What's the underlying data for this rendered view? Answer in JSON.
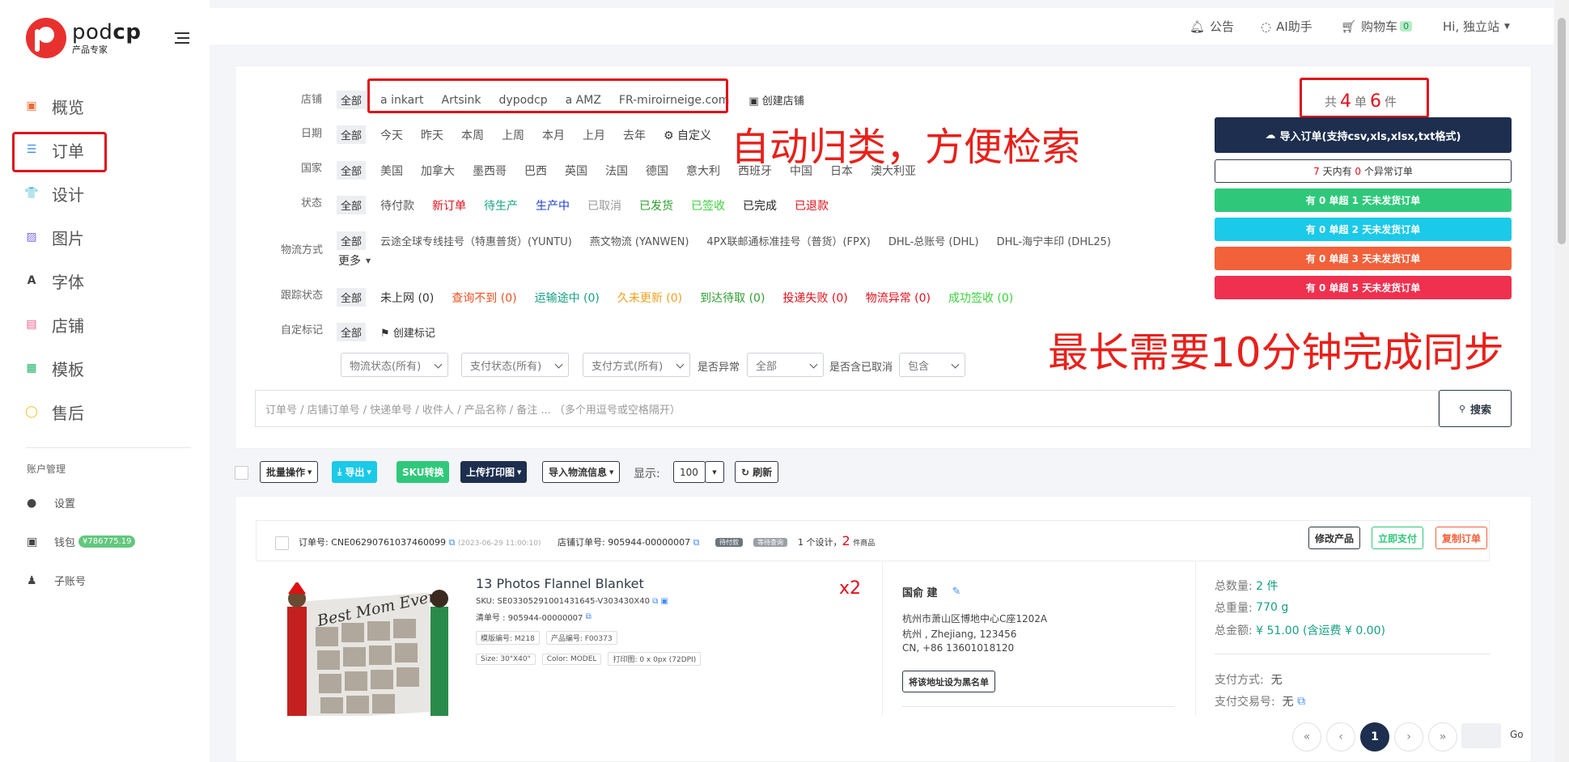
{
  "brand": {
    "name_light": "pod",
    "name_bold": "cp",
    "subtitle": "产品专家"
  },
  "sidebar": {
    "items": [
      {
        "label": "概览"
      },
      {
        "label": "订单"
      },
      {
        "label": "设计"
      },
      {
        "label": "图片"
      },
      {
        "label": "字体"
      },
      {
        "label": "店铺"
      },
      {
        "label": "模板"
      },
      {
        "label": "售后"
      }
    ],
    "account_title": "账户管理",
    "account_items": [
      {
        "label": "设置"
      },
      {
        "label": "钱包",
        "badge": "¥786775.19"
      },
      {
        "label": "子账号"
      }
    ]
  },
  "topbar": {
    "notice": "公告",
    "ai": "AI助手",
    "cart": "购物车",
    "cart_count": "0",
    "user": "Hi, 独立站"
  },
  "filters": {
    "store": {
      "label": "店铺",
      "all": "全部",
      "options": [
        "inkart",
        "Artsink",
        "dypodcp",
        "AMZ",
        "FR-miroirneige.com"
      ],
      "create": "创建店铺"
    },
    "date": {
      "label": "日期",
      "all": "全部",
      "options": [
        "今天",
        "昨天",
        "本周",
        "上周",
        "本月",
        "上月",
        "去年"
      ],
      "custom": "自定义"
    },
    "country": {
      "label": "国家",
      "all": "全部",
      "options": [
        "美国",
        "加拿大",
        "墨西哥",
        "巴西",
        "英国",
        "法国",
        "德国",
        "意大利",
        "西班牙",
        "中国",
        "日本",
        "澳大利亚"
      ]
    },
    "status": {
      "label": "状态",
      "all": "全部",
      "options": [
        "待付款",
        "新订单",
        "待生产",
        "生产中",
        "已取消",
        "已发货",
        "已签收",
        "已完成",
        "已退款"
      ]
    },
    "logistics": {
      "label": "物流方式",
      "all": "全部",
      "options": [
        "云途全球专线挂号（特惠普货）(YUNTU)",
        "燕文物流 (YANWEN)",
        "4PX联邮通标准挂号（普货）(FPX)",
        "DHL-总账号 (DHL)",
        "DHL-海宁丰印 (DHL25)"
      ],
      "more": "更多"
    },
    "tracking": {
      "label": "跟踪状态",
      "all": "全部",
      "options": [
        "未上网 (0)",
        "查询不到 (0)",
        "运输途中 (0)",
        "久未更新 (0)",
        "到达待取 (0)",
        "投递失败 (0)",
        "物流异常 (0)",
        "成功签收 (0)"
      ]
    },
    "custom_mark": {
      "label": "自定标记",
      "all": "全部",
      "create": "创建标记"
    },
    "selects": {
      "logistics_status": "物流状态(所有)",
      "pay_status": "支付状态(所有)",
      "pay_method": "支付方式(所有)",
      "abnormal_label": "是否异常",
      "abnormal_value": "全部",
      "cancel_label": "是否含已取消",
      "cancel_value": "包含"
    },
    "search_placeholder": "订单号 / 店铺订单号 / 快递单号 / 收件人 / 产品名称 / 备注 ... （多个用逗号或空格隔开）",
    "search_button": "搜索"
  },
  "annotations": {
    "auto_classify": "自动归类，方便检索",
    "sync_time": "最长需要10分钟完成同步"
  },
  "summary": {
    "prefix": "共",
    "orders": "4",
    "orders_unit": "单",
    "items": "6",
    "items_unit": "件"
  },
  "right_buttons": {
    "import": "导入订单(支持csv,xls,xlsx,txt格式)",
    "abnormal_a": "7",
    "abnormal_b": "天内有",
    "abnormal_c": "0",
    "abnormal_d": "个异常订单",
    "over1": "有 0 单超 1 天未发货订单",
    "over2": "有 0 单超 2 天未发货订单",
    "over3": "有 0 单超 3 天未发货订单",
    "over5": "有 0 单超 5 天未发货订单"
  },
  "toolbar": {
    "batch": "批量操作",
    "export": "导出",
    "sku": "SKU转换",
    "upload": "上传打印图",
    "import_logistics": "导入物流信息",
    "show_label": "显示:",
    "show_value": "100",
    "refresh": "刷新"
  },
  "order": {
    "order_no": "订单号: CNE06290761037460099",
    "order_time": "(2023-06-29 11:00:10)",
    "store_order_no": "店铺订单号: 905944-00000007",
    "chip1": "待付款",
    "chip2": "等待查询",
    "design_summary_a": "1 个设计，",
    "design_summary_b": "2",
    "design_summary_c": "件商品",
    "btn_modify": "修改产品",
    "btn_pay": "立即支付",
    "btn_copy": "复制订单",
    "product_title": "13 Photos Flannel Blanket",
    "sku": "SKU: SE03305291001431645-V303430X40",
    "list_no": "清单号 : 905944-00000007",
    "template_no": "模版编号: M218",
    "product_no": "产品编号: F00373",
    "size": "Size: 30\"X40\"",
    "color": "Color: MODEL",
    "print_size": "打印图: 0 x 0px (72DPI)",
    "qty_mark": "x2",
    "blanket_text": "Best Mom Ever",
    "recipient": "国俞 建",
    "address1": "杭州市萧山区博地中心C座1202A",
    "address2": "杭州 , Zhejiang, 123456",
    "phone": "CN, +86 13601018120",
    "blacklist": "将该地址设为黑名单",
    "total_qty_label": "总数量:",
    "total_qty": "2 件",
    "total_weight_label": "总重量:",
    "total_weight": "770 g",
    "total_amount_label": "总金额:",
    "total_amount": "¥ 51.00 (含运费 ¥ 0.00)",
    "pay_method_label": "支付方式:",
    "pay_method": "无",
    "pay_tx_label": "支付交易号:",
    "pay_tx": "无"
  },
  "pagination": {
    "first": "«",
    "prev": "‹",
    "current": "1",
    "next": "›",
    "last": "»",
    "go": "Go"
  },
  "colors": {
    "accent_red": "#e0101a",
    "navy": "#1d2e4e",
    "green": "#2fc87a",
    "cyan": "#1bc9e8",
    "orange": "#f2613a",
    "pink": "#f0304f"
  }
}
